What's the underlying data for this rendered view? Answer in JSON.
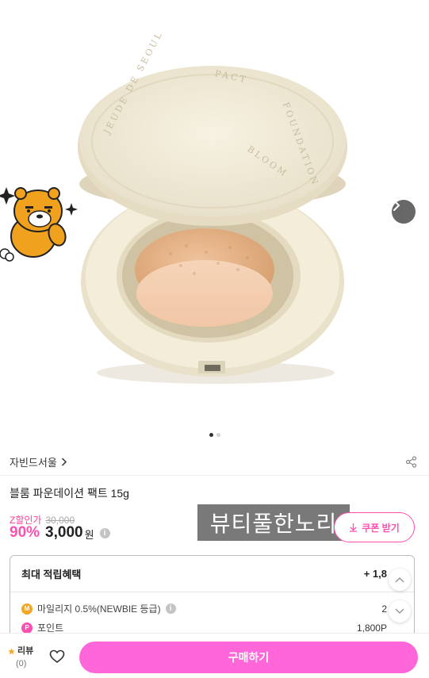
{
  "product": {
    "brand": "자빈드서울",
    "title": "블룸 파운데이션 팩트 15g",
    "price_label": "Z할인가",
    "original_price": "30,000",
    "discount": "90%",
    "sale_price": "3,000",
    "currency": "원",
    "info_glyph": "i",
    "compact_lettering": "JEUDE DE SEOUL · BLOOM FOUNDATION PACT"
  },
  "gallery": {
    "total": 2,
    "current": 1
  },
  "coupon": {
    "label": "쿠폰 받기"
  },
  "watermark": "뷰티풀한노리",
  "benefit": {
    "title": "최대 적립혜택",
    "total": "+ 1,8",
    "rows": [
      {
        "badge": "M",
        "label": "마일리지 0.5%(NEWBIE 등급)",
        "value": "2",
        "color": "#f5a623"
      },
      {
        "badge": "P",
        "label": "포인트",
        "value": "1,800P",
        "color": "#ff4fb0"
      }
    ]
  },
  "bottom": {
    "review_label": "리뷰",
    "review_count": "(0)",
    "buy_label": "구매하기"
  },
  "colors": {
    "accent": "#ff4fb0",
    "buy": "#ff66d9",
    "star": "#f5a623"
  },
  "icons": [
    "chevron-right-icon",
    "share-icon",
    "download-icon",
    "info-icon",
    "chevron-up-icon",
    "chevron-down-icon",
    "star-icon",
    "heart-icon"
  ]
}
